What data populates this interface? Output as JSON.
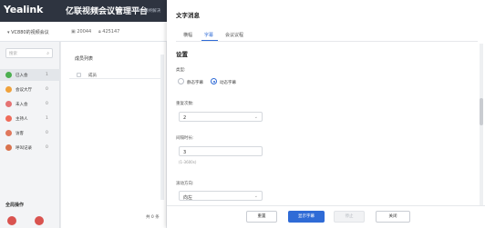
{
  "header": {
    "logo": "Yealink",
    "title": "亿联视频会议管理平台",
    "version": "YMS-最终解决"
  },
  "conference": {
    "name": "VC880的视频会议",
    "id": "20044",
    "password": "425147"
  },
  "sidebar": {
    "search_placeholder": "搜索",
    "items": [
      {
        "label": "已入会",
        "count": "1",
        "color": "#4caf50"
      },
      {
        "label": "会议大厅",
        "count": "0",
        "color": "#f0a23c"
      },
      {
        "label": "未入会",
        "count": "0",
        "color": "#e57373"
      },
      {
        "label": "主持人",
        "count": "1",
        "color": "#ef6c5a"
      },
      {
        "label": "访客",
        "count": "0",
        "color": "#e0785c"
      },
      {
        "label": "呼叫记录",
        "count": "0",
        "color": "#d9734e"
      }
    ],
    "global_ops_title": "全局操作"
  },
  "list": {
    "title": "成员列表",
    "column_header": "成员",
    "pager": "共 0 条"
  },
  "dialog": {
    "title": "文字消息",
    "tabs": [
      {
        "label": "横幅",
        "active": false
      },
      {
        "label": "字幕",
        "active": true
      },
      {
        "label": "会议议程",
        "active": false
      }
    ],
    "section_title": "设置",
    "type_label": "类型:",
    "type_options": [
      {
        "label": "静态字幕",
        "selected": false
      },
      {
        "label": "动态字幕",
        "selected": true
      }
    ],
    "repeat_label": "重复次数:",
    "repeat_value": "2",
    "interval_label": "间隔时长:",
    "interval_value": "3",
    "interval_hint": "(1-3600s)",
    "direction_label": "滚动方向:",
    "direction_value": "向左",
    "buttons": {
      "reset": "重置",
      "show": "显示字幕",
      "stop": "停止",
      "close": "关闭"
    }
  },
  "colors": {
    "accent": "#2f6bd6",
    "header_bg": "#2e3440"
  }
}
